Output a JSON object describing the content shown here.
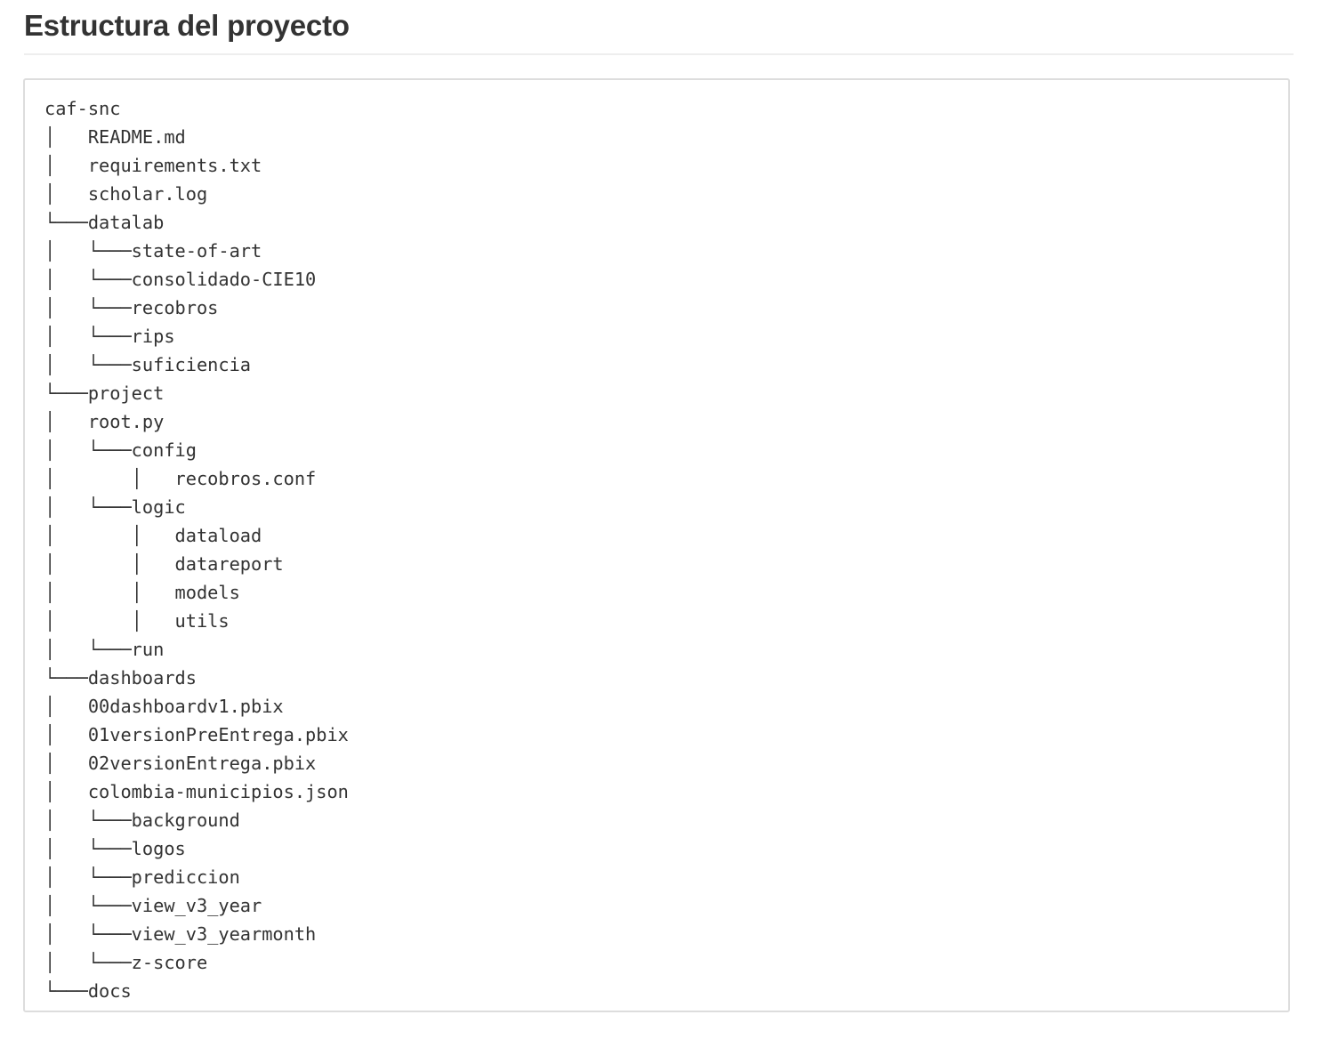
{
  "title": "Estructura del proyecto",
  "tree_lines": [
    "caf-snc",
    "│   README.md",
    "│   requirements.txt",
    "│   scholar.log",
    "└───datalab",
    "│   └───state-of-art",
    "│   └───consolidado-CIE10",
    "│   └───recobros",
    "│   └───rips",
    "│   └───suficiencia",
    "└───project",
    "│   root.py",
    "│   └───config",
    "│       │   recobros.conf",
    "│   └───logic",
    "│       │   dataload",
    "│       │   datareport",
    "│       │   models",
    "│       │   utils",
    "│   └───run",
    "└───dashboards",
    "│   00dashboardv1.pbix",
    "│   01versionPreEntrega.pbix",
    "│   02versionEntrega.pbix",
    "│   colombia-municipios.json",
    "│   └───background",
    "│   └───logos",
    "│   └───prediccion",
    "│   └───view_v3_year",
    "│   └───view_v3_yearmonth",
    "│   └───z-score",
    "└───docs"
  ]
}
